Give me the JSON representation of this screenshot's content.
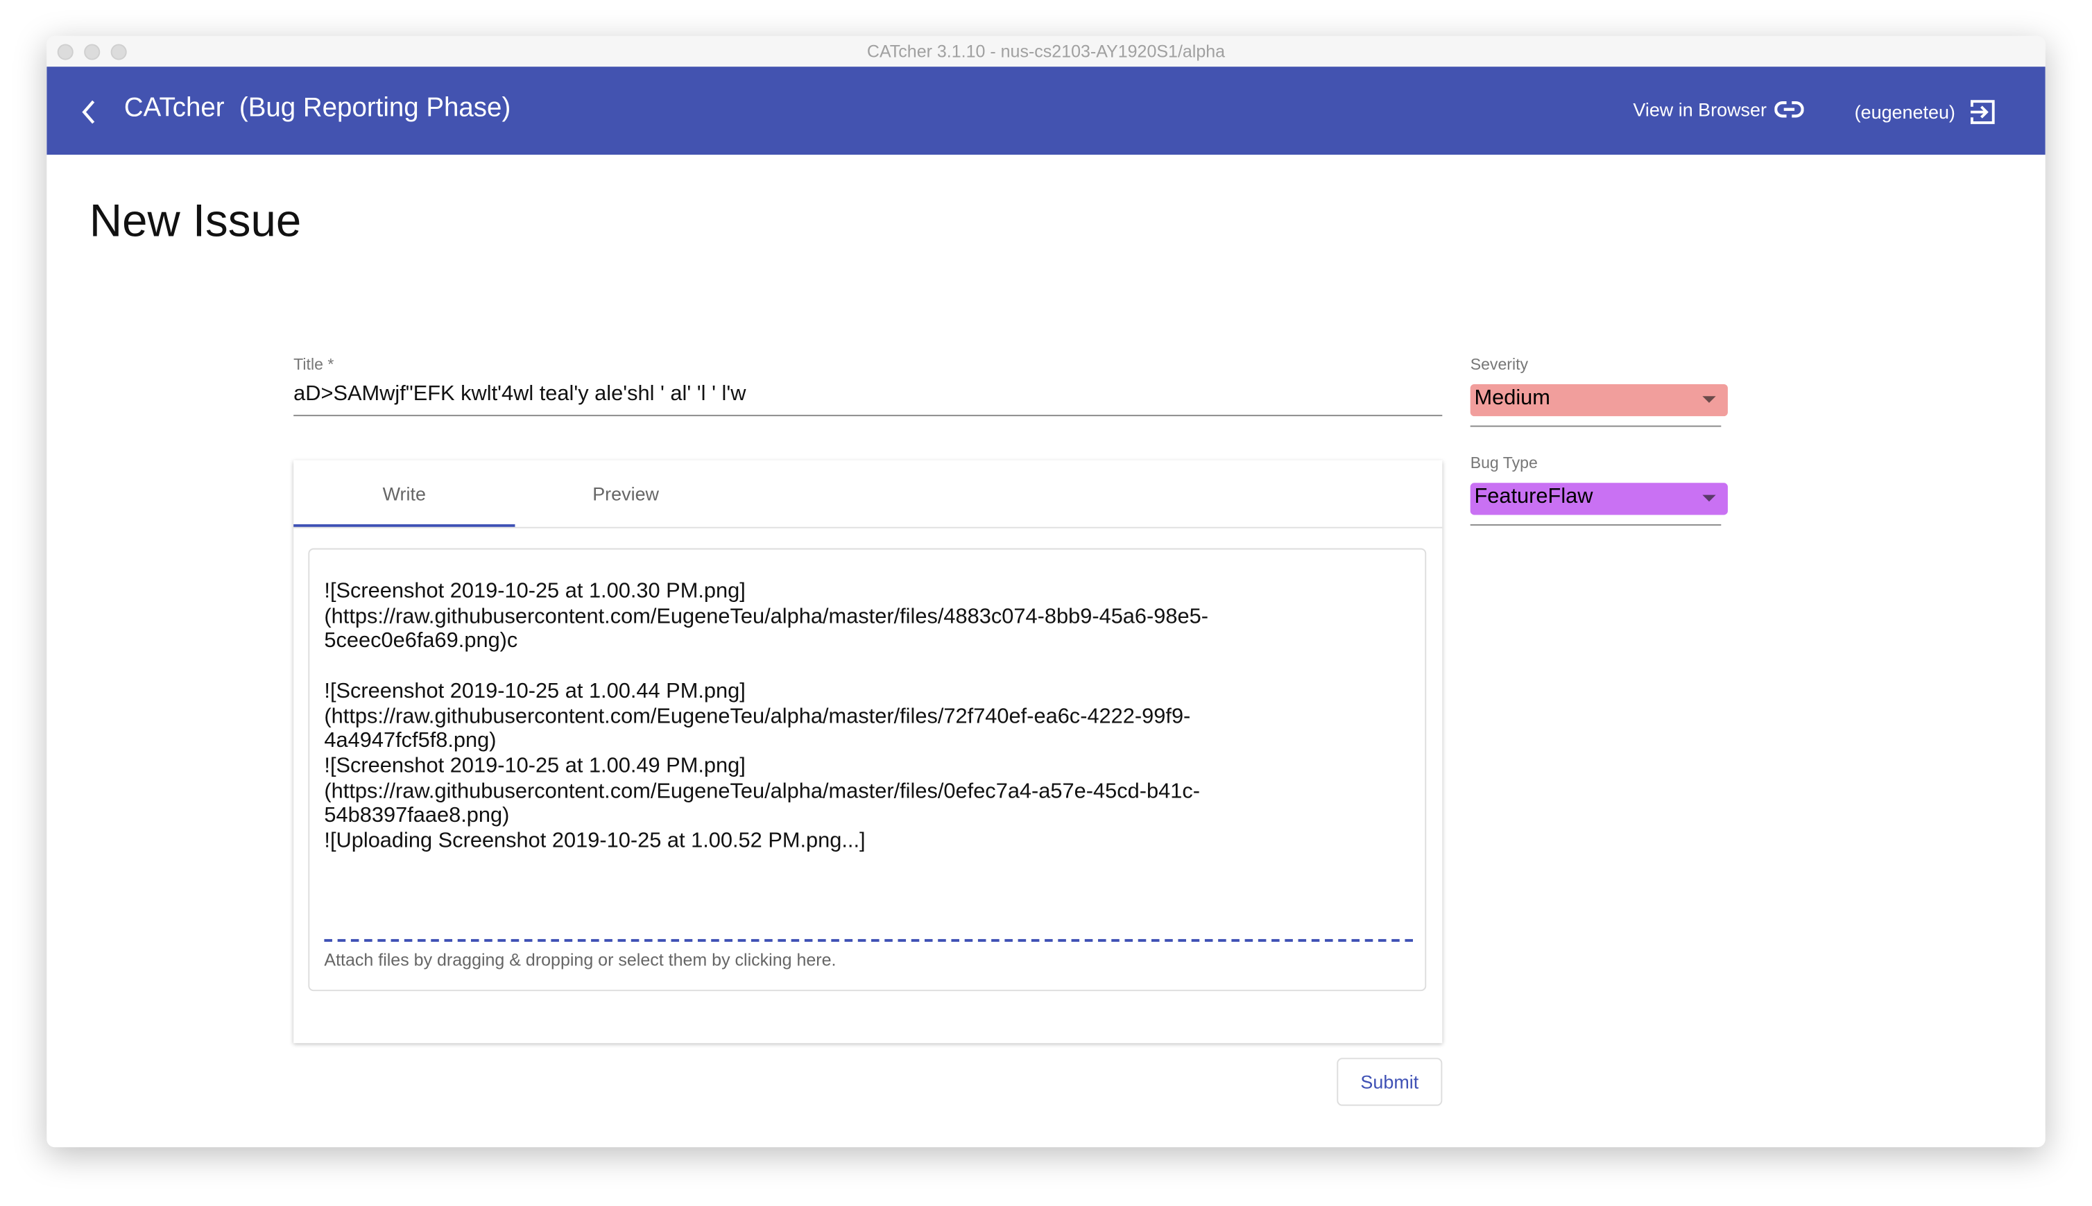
{
  "window": {
    "title": "CATcher 3.1.10 - nus-cs2103-AY1920S1/alpha"
  },
  "appbar": {
    "title": "CATcher  (Bug Reporting Phase)",
    "view_in_browser": "View in Browser",
    "user": "(eugeneteu)"
  },
  "page": {
    "title": "New Issue"
  },
  "form": {
    "title_label": "Title *",
    "title_value": "aD>SAMwjf\"EFK kwlt'4wl teal'y ale'shl ' al' 'l ' l'w",
    "tabs": [
      {
        "label": "Write",
        "active": true
      },
      {
        "label": "Preview",
        "active": false
      }
    ],
    "description": "![Screenshot 2019-10-25 at 1.00.30 PM.png]\n(https://raw.githubusercontent.com/EugeneTeu/alpha/master/files/4883c074-8bb9-45a6-98e5-\n5ceec0e6fa69.png)c\n\n![Screenshot 2019-10-25 at 1.00.44 PM.png]\n(https://raw.githubusercontent.com/EugeneTeu/alpha/master/files/72f740ef-ea6c-4222-99f9-\n4a4947fcf5f8.png)\n![Screenshot 2019-10-25 at 1.00.49 PM.png]\n(https://raw.githubusercontent.com/EugeneTeu/alpha/master/files/0efec7a4-a57e-45cd-b41c-\n54b8397faae8.png)\n![Uploading Screenshot 2019-10-25 at 1.00.52 PM.png...]",
    "attach_hint": "Attach files by dragging & dropping or select them by clicking here.",
    "submit_label": "Submit",
    "severity": {
      "label": "Severity",
      "value": "Medium",
      "color": "#f19e9c"
    },
    "bug_type": {
      "label": "Bug Type",
      "value": "FeatureFlaw",
      "color": "#c971f3"
    }
  },
  "colors": {
    "primary": "#4353b0",
    "accent": "#3f51b5"
  }
}
